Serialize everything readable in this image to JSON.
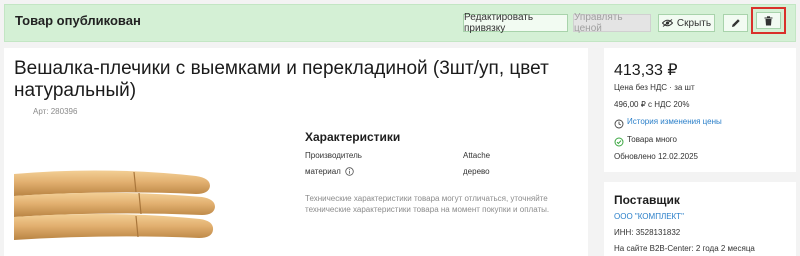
{
  "header": {
    "status_title": "Товар опубликован",
    "edit_binding_label": "Редактировать привязку",
    "manage_price_label": "Управлять ценой",
    "hide_label": "Скрыть"
  },
  "product": {
    "title": "Вешалка-плечики с выемками и перекладиной (3шт/уп, цвет натуральный)",
    "article": "Арт: 280396"
  },
  "characteristics": {
    "title": "Характеристики",
    "rows": [
      {
        "label": "Производитель",
        "value": "Attache"
      },
      {
        "label": "материал",
        "value": "дерево"
      }
    ],
    "disclaimer": "Технические характеристики товара могут отличаться, уточняйте технические характеристики товара на момент покупки и оплаты."
  },
  "pricing": {
    "price": "413,33 ₽",
    "price_note": "Цена без НДС · за шт",
    "price_with_vat": "496,00 ₽ с НДС 20%",
    "history_link": "История изменения цены",
    "stock_status": "Товара много",
    "updated": "Обновлено 12.02.2025"
  },
  "supplier": {
    "title": "Поставщик",
    "name": "ООО \"КОМПЛЕКТ\"",
    "inn": "ИНН: 3528131832",
    "on_site": "На сайте B2B-Center: 2 года 2 месяца"
  },
  "colors": {
    "header_bg": "#d4f0d5",
    "link": "#2a7fc9",
    "delete_highlight": "#d9302a",
    "success_icon": "#3aa640"
  },
  "icons": [
    "eye-hidden-icon",
    "pencil-icon",
    "trash-icon",
    "info-icon",
    "clock-icon",
    "check-circle-icon"
  ]
}
